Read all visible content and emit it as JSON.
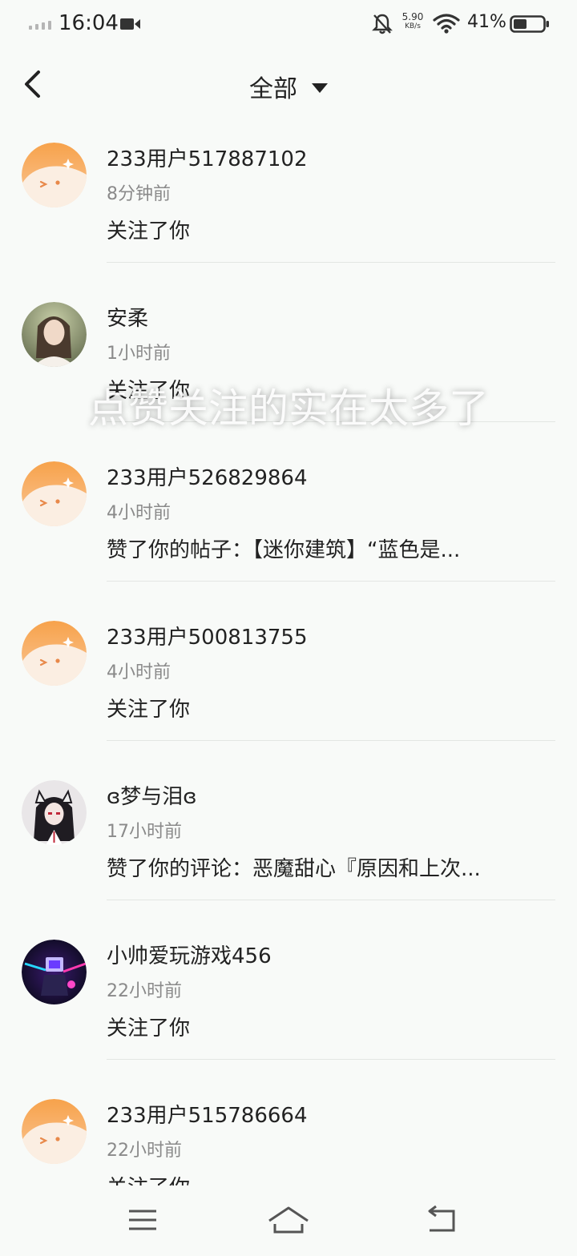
{
  "status_bar": {
    "time": "16:04",
    "net_speed_value": "5.90",
    "net_speed_unit": "KB/s",
    "battery_percent": "41%",
    "icons": [
      "signal-icon",
      "screen-record-icon",
      "bell-muted-icon",
      "wifi-icon",
      "battery-icon"
    ]
  },
  "header": {
    "title": "全部",
    "icons": [
      "back-arrow-icon",
      "caret-down-icon"
    ]
  },
  "notifications": [
    {
      "name": "233用户517887102",
      "time": "8分钟前",
      "action": "关注了你",
      "avatar": "default-orange"
    },
    {
      "name": "安柔",
      "time": "1小时前",
      "action": "关注了你",
      "avatar": "photo-girl"
    },
    {
      "name": "233用户526829864",
      "time": "4小时前",
      "action": "赞了你的帖子：【迷你建筑】“蓝色是...",
      "avatar": "default-orange"
    },
    {
      "name": "233用户500813755",
      "time": "4小时前",
      "action": "关注了你",
      "avatar": "default-orange"
    },
    {
      "name": "ɞ梦与泪ɞ",
      "time": "17小时前",
      "action": "赞了你的评论：恶魔甜心『原因和上次...",
      "avatar": "anime-girl"
    },
    {
      "name": "小帅爱玩游戏456",
      "time": "22小时前",
      "action": "关注了你",
      "avatar": "neon-robot"
    },
    {
      "name": "233用户515786664",
      "time": "22小时前",
      "action": "关注了你",
      "avatar": "default-orange"
    }
  ],
  "overlay_caption": "点赞关注的实在太多了",
  "nav_bar": {
    "icons": [
      "menu-icon",
      "home-icon",
      "return-icon"
    ]
  },
  "colors": {
    "accent_orange": "#f7a24b",
    "background": "#f8faf8",
    "divider": "#e3e6e3",
    "secondary_text": "#8a8a8a"
  }
}
